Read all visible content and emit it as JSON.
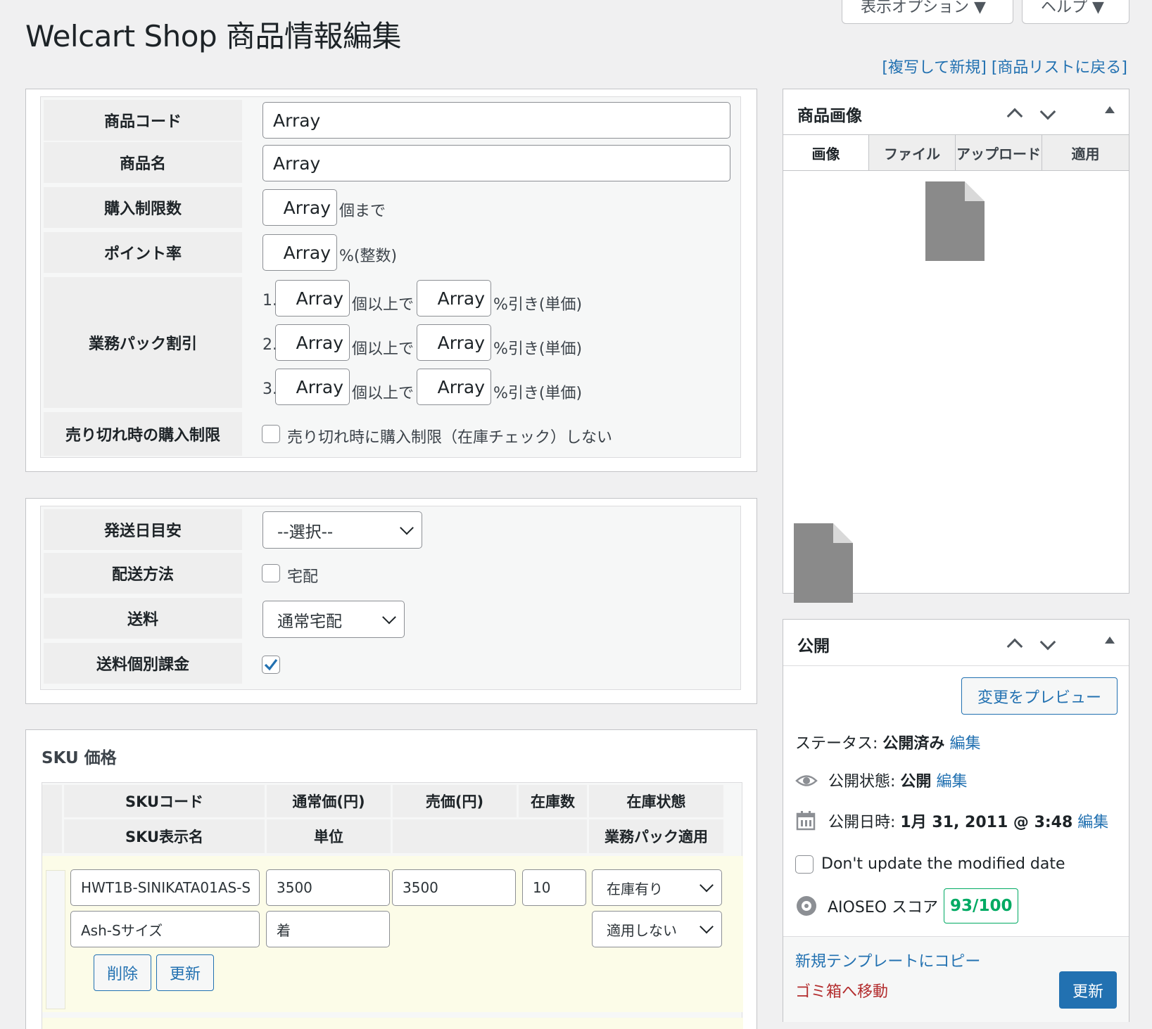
{
  "header": {
    "title": "Welcart Shop 商品情報編集",
    "screen_options": "表示オプション ▼",
    "help": "ヘルプ ▼",
    "duplicate_link": "[複写して新規]",
    "back_link": "[商品リストに戻る]"
  },
  "item_box": {
    "code_label": "商品コード",
    "code_value": "Array",
    "name_label": "商品名",
    "name_value": "Array",
    "limit_label": "購入制限数",
    "limit_value": "Array",
    "limit_suffix": "個まで",
    "point_label": "ポイント率",
    "point_value": "Array",
    "point_suffix": "%(整数)",
    "gp_label": "業務パック割引",
    "gp_rows": [
      {
        "num": "1.",
        "qty": "Array",
        "mid": "個以上で",
        "rate": "Array",
        "suffix": "%引き(単価)"
      },
      {
        "num": "2.",
        "qty": "Array",
        "mid": "個以上で",
        "rate": "Array",
        "suffix": "%引き(単価)"
      },
      {
        "num": "3.",
        "qty": "Array",
        "mid": "個以上で",
        "rate": "Array",
        "suffix": "%引き(単価)"
      }
    ],
    "soldout_label": "売り切れ時の購入制限",
    "soldout_text": "売り切れ時に購入制限（在庫チェック）しない"
  },
  "shipping_box": {
    "ship_date_label": "発送日目安",
    "ship_date_value": "--選択--",
    "method_label": "配送方法",
    "method_option": "宅配",
    "fee_label": "送料",
    "fee_value": "通常宅配",
    "individual_label": "送料個別課金",
    "individual_checked": true
  },
  "sku": {
    "title": "SKU 価格",
    "headers": {
      "code": "SKUコード",
      "normal_price": "通常価(円)",
      "sale_price": "売価(円)",
      "stock": "在庫数",
      "stock_status": "在庫状態",
      "display_name": "SKU表示名",
      "unit": "単位",
      "gp_apply": "業務パック適用"
    },
    "row": {
      "code": "HWT1B-SINIKATA01AS-S",
      "normal_price": "3500",
      "sale_price": "3500",
      "stock": "10",
      "stock_status": "在庫有り",
      "display_name": "Ash-Sサイズ",
      "unit": "着",
      "gp_apply": "適用しない",
      "delete": "削除",
      "update": "更新"
    }
  },
  "image_box": {
    "title": "商品画像",
    "tabs": [
      "画像",
      "ファイル",
      "アップロード",
      "適用"
    ]
  },
  "publish_box": {
    "title": "公開",
    "preview": "変更をプレビュー",
    "status_label": "ステータス:",
    "status_value": "公開済み",
    "visibility_label": "公開状態:",
    "visibility_value": "公開",
    "date_label": "公開日時:",
    "date_value": "1月 31, 2011 @ 3:48",
    "edit": "編集",
    "dont_update": "Don't update the modified date",
    "aioseo_label": "AIOSEO スコア",
    "aioseo_score": "93/100",
    "copy_template": "新規テンプレートにコピー",
    "trash": "ゴミ箱へ移動",
    "update": "更新"
  },
  "colors": {
    "link": "#2271b1",
    "trash": "#b32d2e",
    "score": "#00aa63",
    "sku_row_bg": "#fcfce8"
  }
}
